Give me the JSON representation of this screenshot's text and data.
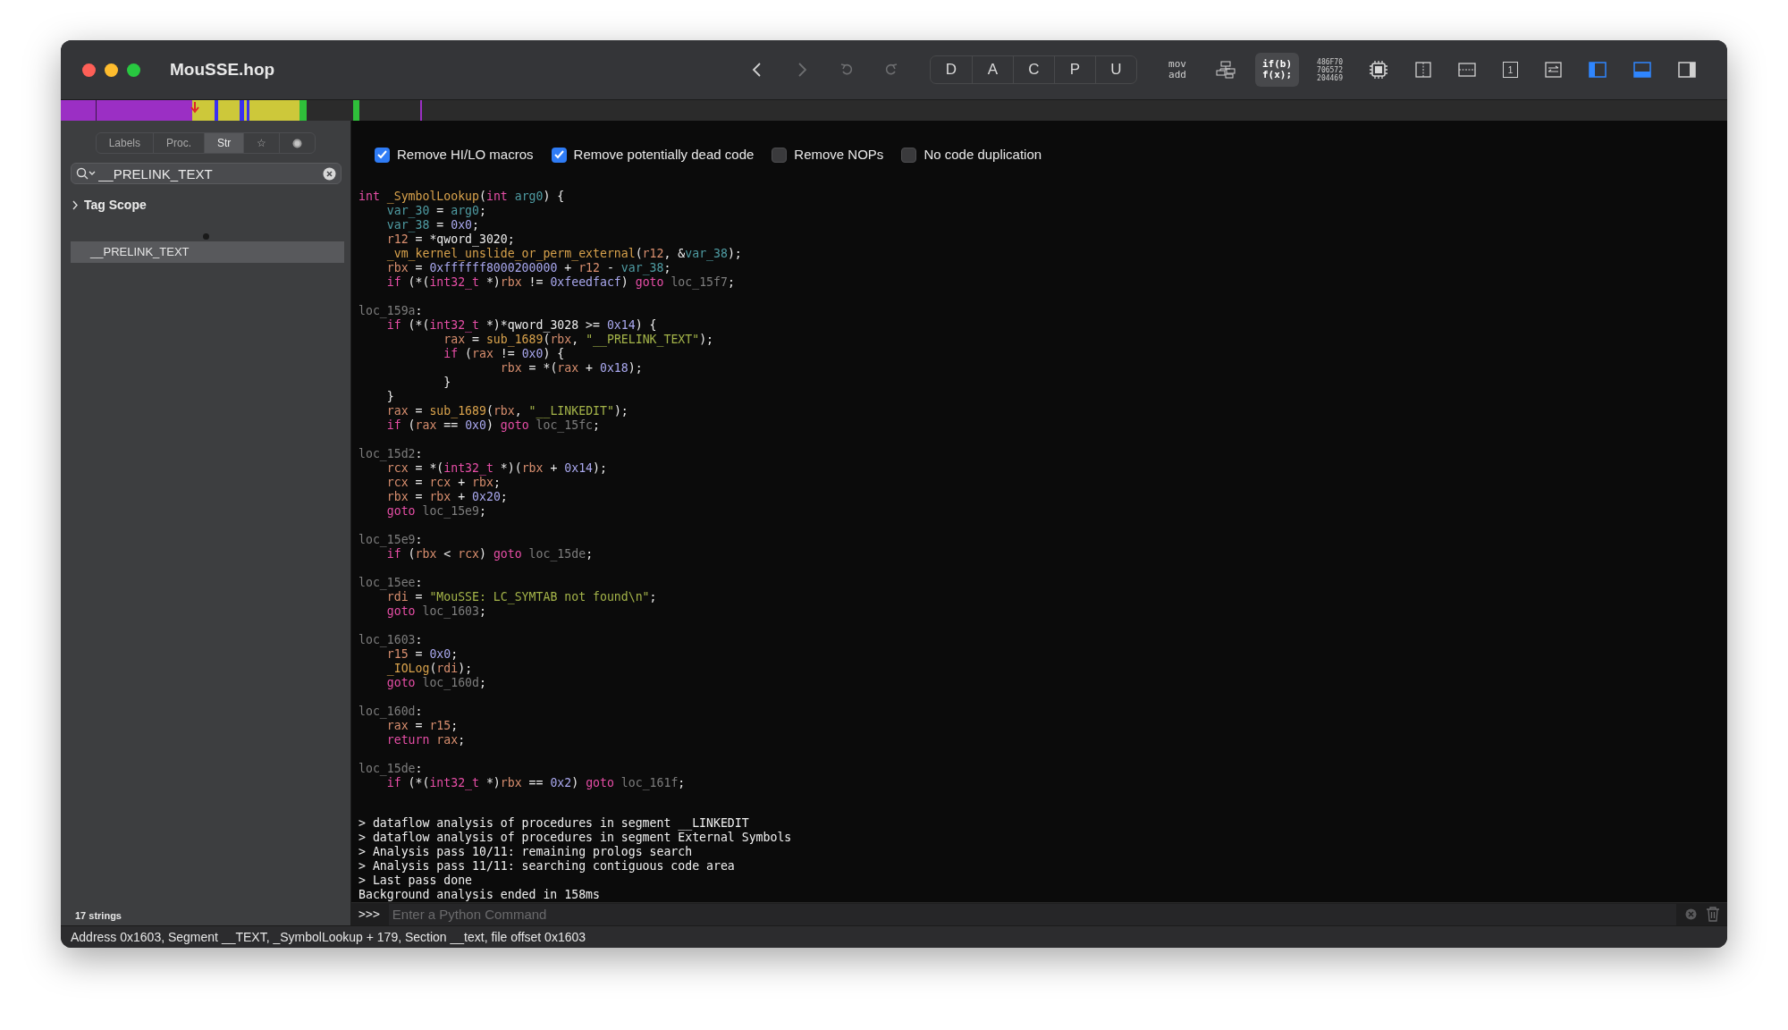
{
  "window": {
    "title": "MouSSE.hop"
  },
  "toolbar": {
    "nav": [
      {
        "kind": "back",
        "disabled": false
      },
      {
        "kind": "forward",
        "disabled": true
      },
      {
        "kind": "undo",
        "disabled": true
      },
      {
        "kind": "redo",
        "disabled": true
      }
    ],
    "modes": [
      "D",
      "A",
      "C",
      "P",
      "U"
    ],
    "views": [
      {
        "kind": "asm",
        "lines": [
          "mov",
          "add"
        ],
        "selected": false
      },
      {
        "kind": "graph",
        "selected": false
      },
      {
        "kind": "pseudo",
        "lines": [
          "if(b)",
          "f(x);"
        ],
        "selected": true
      },
      {
        "kind": "hex",
        "lines": [
          "486F70",
          "706572",
          "204469"
        ],
        "selected": false
      }
    ],
    "tools": [
      {
        "kind": "chip"
      },
      {
        "kind": "split-vertical"
      },
      {
        "kind": "split-horizontal"
      },
      {
        "kind": "numbered",
        "label": "1"
      },
      {
        "kind": "swap"
      }
    ],
    "panels": [
      {
        "kind": "left",
        "on": true
      },
      {
        "kind": "bottom",
        "on": true
      },
      {
        "kind": "right",
        "on": false
      }
    ]
  },
  "sidebar": {
    "tabs": [
      {
        "kind": "text",
        "label": "Labels",
        "selected": false
      },
      {
        "kind": "text",
        "label": "Proc.",
        "selected": false
      },
      {
        "kind": "text",
        "label": "Str",
        "selected": true
      },
      {
        "kind": "text",
        "label": "☆",
        "selected": false
      },
      {
        "kind": "dot",
        "selected": false
      }
    ],
    "search": {
      "value": "__PRELINK_TEXT"
    },
    "tag_scope": {
      "label": "Tag Scope",
      "expanded": false
    },
    "items": [
      {
        "label": "__PRELINK_TEXT",
        "selected": true
      }
    ],
    "count": "17 strings"
  },
  "options": [
    {
      "label": "Remove HI/LO macros",
      "checked": true
    },
    {
      "label": "Remove potentially dead code",
      "checked": true
    },
    {
      "label": "Remove NOPs",
      "checked": false
    },
    {
      "label": "No code duplication",
      "checked": false
    }
  ],
  "code": [
    [
      [
        {
          "kind": "kw",
          "text": "int "
        },
        {
          "kind": "fn",
          "text": "_SymbolLookup"
        },
        {
          "kind": "p",
          "text": "("
        },
        {
          "kind": "kw",
          "text": "int "
        },
        {
          "kind": "var",
          "text": "arg0"
        },
        {
          "kind": "p",
          "text": ") {"
        }
      ],
      [
        {
          "kind": "var",
          "text": "    var_30"
        },
        {
          "kind": "p",
          "text": " = "
        },
        {
          "kind": "var",
          "text": "arg0"
        },
        {
          "kind": "p",
          "text": ";"
        }
      ],
      [
        {
          "kind": "var",
          "text": "    var_38"
        },
        {
          "kind": "p",
          "text": " = "
        },
        {
          "kind": "num",
          "text": "0x0"
        },
        {
          "kind": "p",
          "text": ";"
        }
      ],
      [
        {
          "kind": "reg",
          "text": "    r12"
        },
        {
          "kind": "p",
          "text": " = *qword_3020;"
        }
      ],
      [
        {
          "kind": "fn",
          "text": "    _vm_kernel_unslide_or_perm_external"
        },
        {
          "kind": "p",
          "text": "("
        },
        {
          "kind": "reg",
          "text": "r12"
        },
        {
          "kind": "p",
          "text": ", &"
        },
        {
          "kind": "var",
          "text": "var_38"
        },
        {
          "kind": "p",
          "text": ");"
        }
      ],
      [
        {
          "kind": "reg",
          "text": "    rbx"
        },
        {
          "kind": "p",
          "text": " = "
        },
        {
          "kind": "num",
          "text": "0xffffff8000200000"
        },
        {
          "kind": "p",
          "text": " + "
        },
        {
          "kind": "reg",
          "text": "r12"
        },
        {
          "kind": "p",
          "text": " - "
        },
        {
          "kind": "var",
          "text": "var_38"
        },
        {
          "kind": "p",
          "text": ";"
        }
      ],
      [
        {
          "kind": "kw",
          "text": "    if"
        },
        {
          "kind": "p",
          "text": " (*("
        },
        {
          "kind": "kw",
          "text": "int32_t"
        },
        {
          "kind": "p",
          "text": " *)"
        },
        {
          "kind": "reg",
          "text": "rbx"
        },
        {
          "kind": "p",
          "text": " != "
        },
        {
          "kind": "num",
          "text": "0xfeedfacf"
        },
        {
          "kind": "p",
          "text": ") "
        },
        {
          "kind": "kw",
          "text": "goto "
        },
        {
          "kind": "lbl",
          "text": "loc_15f7"
        },
        {
          "kind": "p",
          "text": ";"
        }
      ]
    ],
    [
      [
        {
          "kind": "lbl",
          "text": "loc_159a"
        },
        {
          "kind": "p",
          "text": ":"
        }
      ],
      [
        {
          "kind": "kw",
          "text": "    if"
        },
        {
          "kind": "p",
          "text": " (*("
        },
        {
          "kind": "kw",
          "text": "int32_t"
        },
        {
          "kind": "p",
          "text": " *)*qword_3028 >= "
        },
        {
          "kind": "num",
          "text": "0x14"
        },
        {
          "kind": "p",
          "text": ") {"
        }
      ],
      [
        {
          "kind": "reg",
          "text": "            rax"
        },
        {
          "kind": "p",
          "text": " = "
        },
        {
          "kind": "fn",
          "text": "sub_1689"
        },
        {
          "kind": "p",
          "text": "("
        },
        {
          "kind": "reg",
          "text": "rbx"
        },
        {
          "kind": "p",
          "text": ", "
        },
        {
          "kind": "str",
          "text": "\"__PRELINK_TEXT\""
        },
        {
          "kind": "p",
          "text": ");"
        }
      ],
      [
        {
          "kind": "kw",
          "text": "            if"
        },
        {
          "kind": "p",
          "text": " ("
        },
        {
          "kind": "reg",
          "text": "rax"
        },
        {
          "kind": "p",
          "text": " != "
        },
        {
          "kind": "num",
          "text": "0x0"
        },
        {
          "kind": "p",
          "text": ") {"
        }
      ],
      [
        {
          "kind": "reg",
          "text": "                    rbx"
        },
        {
          "kind": "p",
          "text": " = *("
        },
        {
          "kind": "reg",
          "text": "rax"
        },
        {
          "kind": "p",
          "text": " + "
        },
        {
          "kind": "num",
          "text": "0x18"
        },
        {
          "kind": "p",
          "text": ");"
        }
      ],
      [
        {
          "kind": "p",
          "text": "            }"
        }
      ],
      [
        {
          "kind": "p",
          "text": "    }"
        }
      ],
      [
        {
          "kind": "reg",
          "text": "    rax"
        },
        {
          "kind": "p",
          "text": " = "
        },
        {
          "kind": "fn",
          "text": "sub_1689"
        },
        {
          "kind": "p",
          "text": "("
        },
        {
          "kind": "reg",
          "text": "rbx"
        },
        {
          "kind": "p",
          "text": ", "
        },
        {
          "kind": "str",
          "text": "\"__LINKEDIT\""
        },
        {
          "kind": "p",
          "text": ");"
        }
      ],
      [
        {
          "kind": "kw",
          "text": "    if"
        },
        {
          "kind": "p",
          "text": " ("
        },
        {
          "kind": "reg",
          "text": "rax"
        },
        {
          "kind": "p",
          "text": " == "
        },
        {
          "kind": "num",
          "text": "0x0"
        },
        {
          "kind": "p",
          "text": ") "
        },
        {
          "kind": "kw",
          "text": "goto "
        },
        {
          "kind": "lbl",
          "text": "loc_15fc"
        },
        {
          "kind": "p",
          "text": ";"
        }
      ]
    ],
    [
      [
        {
          "kind": "lbl",
          "text": "loc_15d2"
        },
        {
          "kind": "p",
          "text": ":"
        }
      ],
      [
        {
          "kind": "reg",
          "text": "    rcx"
        },
        {
          "kind": "p",
          "text": " = *("
        },
        {
          "kind": "kw",
          "text": "int32_t"
        },
        {
          "kind": "p",
          "text": " *)("
        },
        {
          "kind": "reg",
          "text": "rbx"
        },
        {
          "kind": "p",
          "text": " + "
        },
        {
          "kind": "num",
          "text": "0x14"
        },
        {
          "kind": "p",
          "text": ");"
        }
      ],
      [
        {
          "kind": "reg",
          "text": "    rcx"
        },
        {
          "kind": "p",
          "text": " = "
        },
        {
          "kind": "reg",
          "text": "rcx"
        },
        {
          "kind": "p",
          "text": " + "
        },
        {
          "kind": "reg",
          "text": "rbx"
        },
        {
          "kind": "p",
          "text": ";"
        }
      ],
      [
        {
          "kind": "reg",
          "text": "    rbx"
        },
        {
          "kind": "p",
          "text": " = "
        },
        {
          "kind": "reg",
          "text": "rbx"
        },
        {
          "kind": "p",
          "text": " + "
        },
        {
          "kind": "num",
          "text": "0x20"
        },
        {
          "kind": "p",
          "text": ";"
        }
      ],
      [
        {
          "kind": "kw",
          "text": "    goto "
        },
        {
          "kind": "lbl",
          "text": "loc_15e9"
        },
        {
          "kind": "p",
          "text": ";"
        }
      ]
    ],
    [
      [
        {
          "kind": "lbl",
          "text": "loc_15e9"
        },
        {
          "kind": "p",
          "text": ":"
        }
      ],
      [
        {
          "kind": "kw",
          "text": "    if"
        },
        {
          "kind": "p",
          "text": " ("
        },
        {
          "kind": "reg",
          "text": "rbx"
        },
        {
          "kind": "p",
          "text": " < "
        },
        {
          "kind": "reg",
          "text": "rcx"
        },
        {
          "kind": "p",
          "text": ") "
        },
        {
          "kind": "kw",
          "text": "goto "
        },
        {
          "kind": "lbl",
          "text": "loc_15de"
        },
        {
          "kind": "p",
          "text": ";"
        }
      ]
    ],
    [
      [
        {
          "kind": "lbl",
          "text": "loc_15ee"
        },
        {
          "kind": "p",
          "text": ":"
        }
      ],
      [
        {
          "kind": "reg",
          "text": "    rdi"
        },
        {
          "kind": "p",
          "text": " = "
        },
        {
          "kind": "str",
          "text": "\"MouSSE: LC_SYMTAB not found\\n\""
        },
        {
          "kind": "p",
          "text": ";"
        }
      ],
      [
        {
          "kind": "kw",
          "text": "    goto "
        },
        {
          "kind": "lbl",
          "text": "loc_1603"
        },
        {
          "kind": "p",
          "text": ";"
        }
      ]
    ],
    [
      [
        {
          "kind": "lbl",
          "text": "loc_1603"
        },
        {
          "kind": "p",
          "text": ":"
        }
      ],
      [
        {
          "kind": "reg",
          "text": "    r15"
        },
        {
          "kind": "p",
          "text": " = "
        },
        {
          "kind": "num",
          "text": "0x0"
        },
        {
          "kind": "p",
          "text": ";"
        }
      ],
      [
        {
          "kind": "fn",
          "text": "    _IOLog"
        },
        {
          "kind": "p",
          "text": "("
        },
        {
          "kind": "reg",
          "text": "rdi"
        },
        {
          "kind": "p",
          "text": ");"
        }
      ],
      [
        {
          "kind": "kw",
          "text": "    goto "
        },
        {
          "kind": "lbl",
          "text": "loc_160d"
        },
        {
          "kind": "p",
          "text": ";"
        }
      ]
    ],
    [
      [
        {
          "kind": "lbl",
          "text": "loc_160d"
        },
        {
          "kind": "p",
          "text": ":"
        }
      ],
      [
        {
          "kind": "reg",
          "text": "    rax"
        },
        {
          "kind": "p",
          "text": " = "
        },
        {
          "kind": "reg",
          "text": "r15"
        },
        {
          "kind": "p",
          "text": ";"
        }
      ],
      [
        {
          "kind": "kw",
          "text": "    return "
        },
        {
          "kind": "reg",
          "text": "rax"
        },
        {
          "kind": "p",
          "text": ";"
        }
      ]
    ],
    [
      [
        {
          "kind": "lbl",
          "text": "loc_15de"
        },
        {
          "kind": "p",
          "text": ":"
        }
      ],
      [
        {
          "kind": "kw",
          "text": "    if"
        },
        {
          "kind": "p",
          "text": " (*("
        },
        {
          "kind": "kw",
          "text": "int32_t"
        },
        {
          "kind": "p",
          "text": " *)"
        },
        {
          "kind": "reg",
          "text": "rbx"
        },
        {
          "kind": "p",
          "text": " == "
        },
        {
          "kind": "num",
          "text": "0x2"
        },
        {
          "kind": "p",
          "text": ") "
        },
        {
          "kind": "kw",
          "text": "goto "
        },
        {
          "kind": "lbl",
          "text": "loc_161f"
        },
        {
          "kind": "p",
          "text": ";"
        }
      ]
    ]
  ],
  "console": {
    "lines": [
      "> dataflow analysis of procedures in segment __LINKEDIT",
      "> dataflow analysis of procedures in segment External Symbols",
      "> Analysis pass 10/11: remaining prologs search",
      "> Analysis pass 11/11: searching contiguous code area",
      "> Last pass done",
      "Background analysis ended in 158ms"
    ],
    "prompt": ">>>",
    "placeholder": "Enter a Python Command"
  },
  "status_bar": "Address 0x1603, Segment __TEXT, _SymbolLookup + 179, Section __text, file offset 0x1603"
}
